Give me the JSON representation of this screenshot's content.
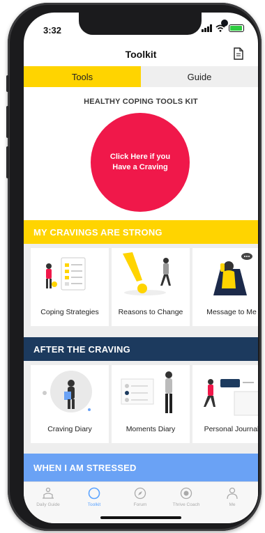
{
  "status_bar": {
    "time": "3:32"
  },
  "header": {
    "title": "Toolkit",
    "doc_icon": "document-icon"
  },
  "tabs": [
    {
      "label": "Tools",
      "active": true
    },
    {
      "label": "Guide",
      "active": false
    }
  ],
  "kit": {
    "title": "HEALTHY COPING TOOLS KIT",
    "craving_button": "Click Here if you Have a Craving"
  },
  "sections": [
    {
      "title": "MY CRAVINGS ARE STRONG",
      "items": [
        {
          "label": "Coping Strategies",
          "icon": "checklist-illustration"
        },
        {
          "label": "Reasons to Change",
          "icon": "exclamation-illustration"
        },
        {
          "label": "Message to Me",
          "icon": "message-illustration"
        }
      ]
    },
    {
      "title": "AFTER THE CRAVING",
      "items": [
        {
          "label": "Craving Diary",
          "icon": "diary-illustration"
        },
        {
          "label": "Moments Diary",
          "icon": "moments-illustration"
        },
        {
          "label": "Personal Journal",
          "icon": "journal-illustration"
        }
      ]
    },
    {
      "title": "WHEN I AM STRESSED",
      "items": []
    }
  ],
  "tab_bar": [
    {
      "label": "Daily Guide",
      "icon": "guide-icon",
      "active": false
    },
    {
      "label": "Toolkit",
      "icon": "circle-icon",
      "active": true
    },
    {
      "label": "Forum",
      "icon": "compass-icon",
      "active": false
    },
    {
      "label": "Thrive Coach",
      "icon": "chat-icon",
      "active": false
    },
    {
      "label": "Me",
      "icon": "person-icon",
      "active": false
    }
  ],
  "colors": {
    "accent_yellow": "#ffd400",
    "craving_red": "#f0184a",
    "navy": "#1c3a5e",
    "stress_blue": "#6aa2f5",
    "active_tab": "#5aa3ff"
  }
}
